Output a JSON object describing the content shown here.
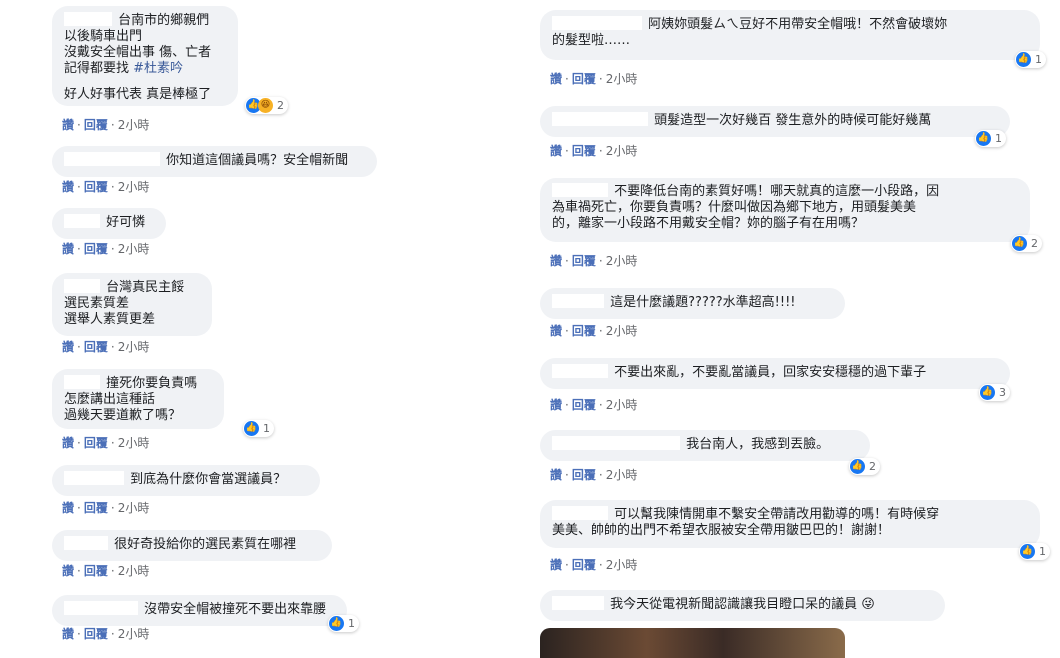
{
  "actions": {
    "like": "讚",
    "reply": "回覆",
    "sep": "·",
    "time": "2小時"
  },
  "left_comments": [
    {
      "lines": [
        "台南市的鄉親們",
        "以後騎車出門",
        "沒戴安全帽出事 傷、亡者",
        "記得都要找 #杜素吟",
        "",
        "好人好事代表 真是棒極了"
      ],
      "hashtag": "#杜素吟",
      "reactions": {
        "count": "2",
        "types": [
          "like",
          "haha"
        ]
      }
    },
    {
      "lines": [
        "你知道這個議員嗎？安全帽新聞"
      ]
    },
    {
      "lines": [
        "好可憐"
      ]
    },
    {
      "lines": [
        "台灣真民主餒",
        "選民素質差",
        "選舉人素質更差"
      ]
    },
    {
      "lines": [
        "撞死你要負責嗎",
        "怎麼講出這種話",
        "過幾天要道歉了嗎？"
      ],
      "reactions": {
        "count": "1",
        "types": [
          "like"
        ]
      }
    },
    {
      "lines": [
        "到底為什麼你會當選議員？"
      ]
    },
    {
      "lines": [
        "很好奇投給你的選民素質在哪裡"
      ]
    },
    {
      "lines": [
        "沒帶安全帽被撞死不要出來靠腰"
      ],
      "reactions": {
        "count": "1",
        "types": [
          "like"
        ]
      }
    }
  ],
  "right_comments": [
    {
      "lines": [
        "阿姨妳頭髮ㄙㄟ豆好不用帶安全帽哦！不然會破壞妳",
        "的髮型啦……"
      ],
      "reactions": {
        "count": "1",
        "types": [
          "like"
        ]
      }
    },
    {
      "lines": [
        "頭髮造型一次好幾百 發生意外的時候可能好幾萬"
      ],
      "reactions": {
        "count": "1",
        "types": [
          "like"
        ]
      }
    },
    {
      "lines": [
        "不要降低台南的素質好嗎！哪天就真的這麼一小段路，因",
        "為車禍死亡，你要負責嗎？什麼叫做因為鄉下地方，用頭髮美美",
        "的，離家一小段路不用戴安全帽？妳的腦子有在用嗎？"
      ],
      "reactions": {
        "count": "2",
        "types": [
          "like"
        ]
      }
    },
    {
      "lines": [
        "這是什麼議題?????水準超高!!!!"
      ]
    },
    {
      "lines": [
        "不要出來亂，不要亂當議員，回家安安穩穩的過下輩子"
      ],
      "reactions": {
        "count": "3",
        "types": [
          "like"
        ]
      }
    },
    {
      "lines": [
        "我台南人，我感到丟臉。"
      ],
      "reactions": {
        "count": "2",
        "types": [
          "like"
        ]
      }
    },
    {
      "lines": [
        "可以幫我陳情開車不繫安全帶請改用勸導的嗎！有時候穿",
        "美美、帥帥的出門不希望衣服被安全帶用皺巴巴的！謝謝！"
      ],
      "reactions": {
        "count": "1",
        "types": [
          "like"
        ]
      }
    },
    {
      "lines": [
        "我今天從電視新聞認識讓我目瞪口呆的議員 😜"
      ]
    }
  ],
  "icons": {
    "like": "like-thumb-icon",
    "haha": "haha-emoji-icon"
  },
  "colors": {
    "bubble": "#f0f2f5",
    "like_blue": "#1877f2",
    "link": "#4b6fb8",
    "meta": "#65676b"
  }
}
